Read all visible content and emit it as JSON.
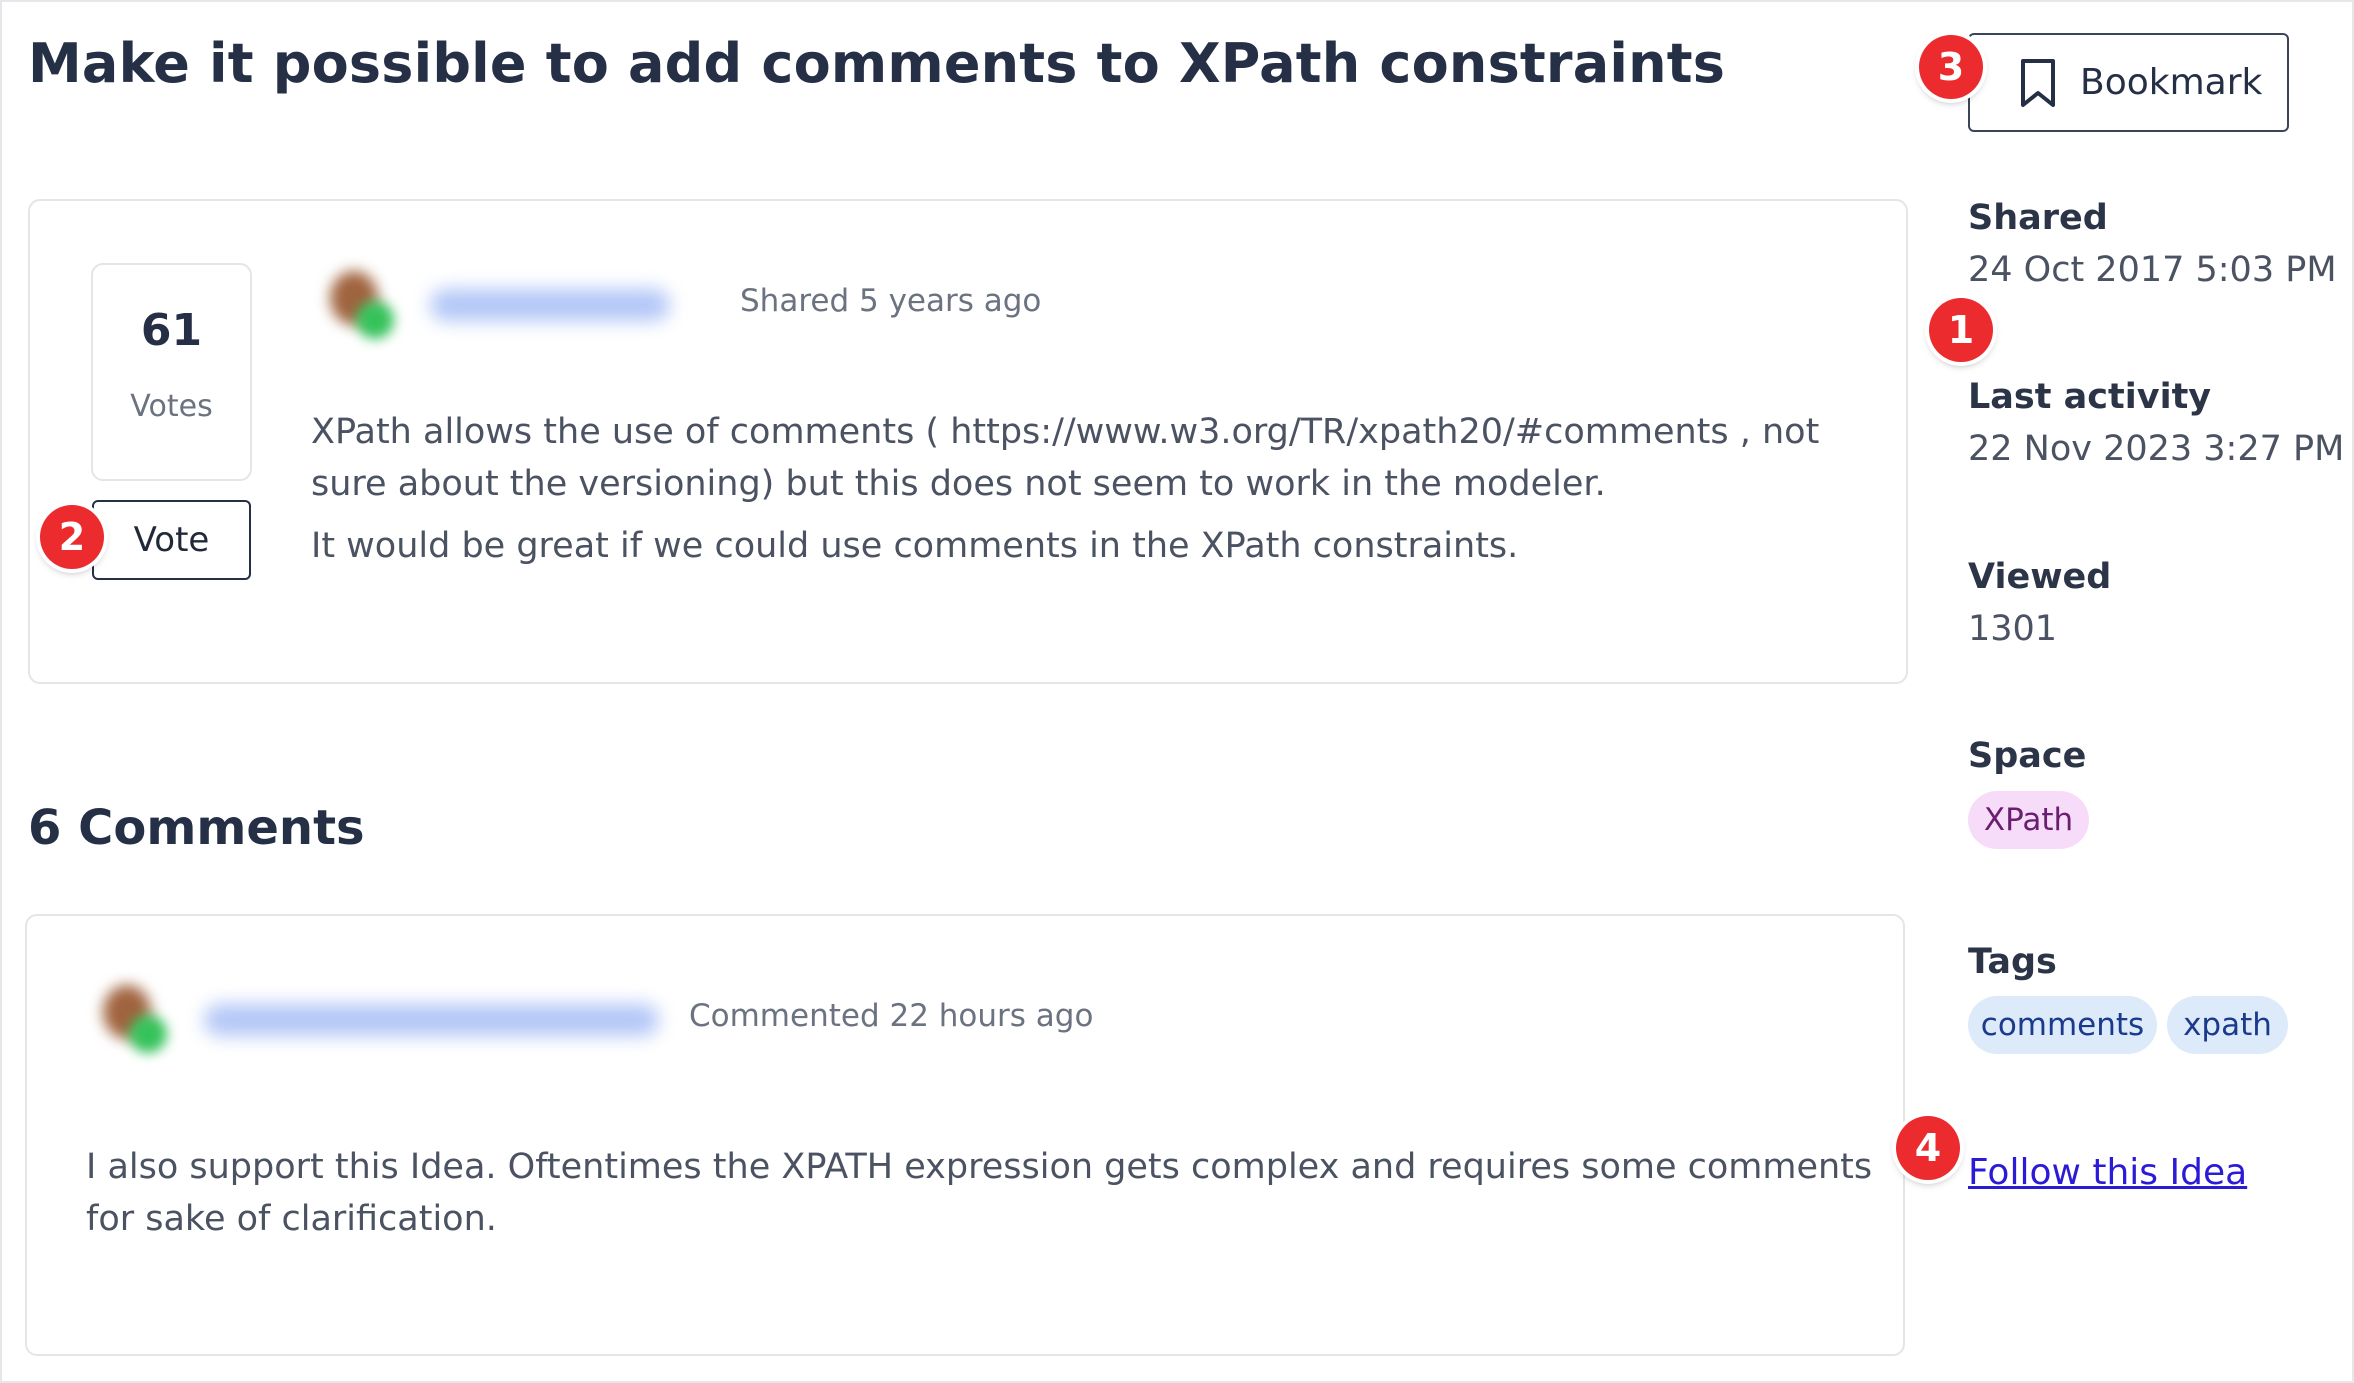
{
  "page": {
    "title": "Make it possible to add comments to XPath constraints"
  },
  "bookmark": {
    "label": "Bookmark",
    "icon": "bookmark-icon"
  },
  "idea": {
    "votes_count": "61",
    "votes_label": "Votes",
    "vote_button": "Vote",
    "shared_text": "Shared 5 years ago",
    "paragraphs": [
      "XPath allows the use of comments ( https://www.w3.org/TR/xpath20/#comments , not sure about the versioning)  but this does not seem to work in the modeler.",
      "It would be great if we could use comments in the XPath constraints."
    ]
  },
  "comments": {
    "heading": "6 Comments",
    "items": [
      {
        "meta": "Commented 22 hours ago",
        "text": "I also support this Idea. Oftentimes the XPATH expression gets complex and requires some comments for sake of clarification."
      }
    ]
  },
  "sidebar": {
    "shared_label": "Shared",
    "shared_value": "24 Oct 2017 5:03 PM",
    "last_activity_label": "Last activity",
    "last_activity_value": "22 Nov 2023 3:27 PM",
    "viewed_label": "Viewed",
    "viewed_value": "1301",
    "space_label": "Space",
    "space_value": "XPath",
    "tags_label": "Tags",
    "tags": [
      "comments",
      "xpath"
    ],
    "follow_link": "Follow this Idea"
  },
  "annotations": [
    "1",
    "2",
    "3",
    "4"
  ],
  "colors": {
    "badge": "#ec2b2f",
    "link": "#2c1bd6",
    "space_chip": "#f6dcf8",
    "tag_chip": "#dceafa"
  }
}
